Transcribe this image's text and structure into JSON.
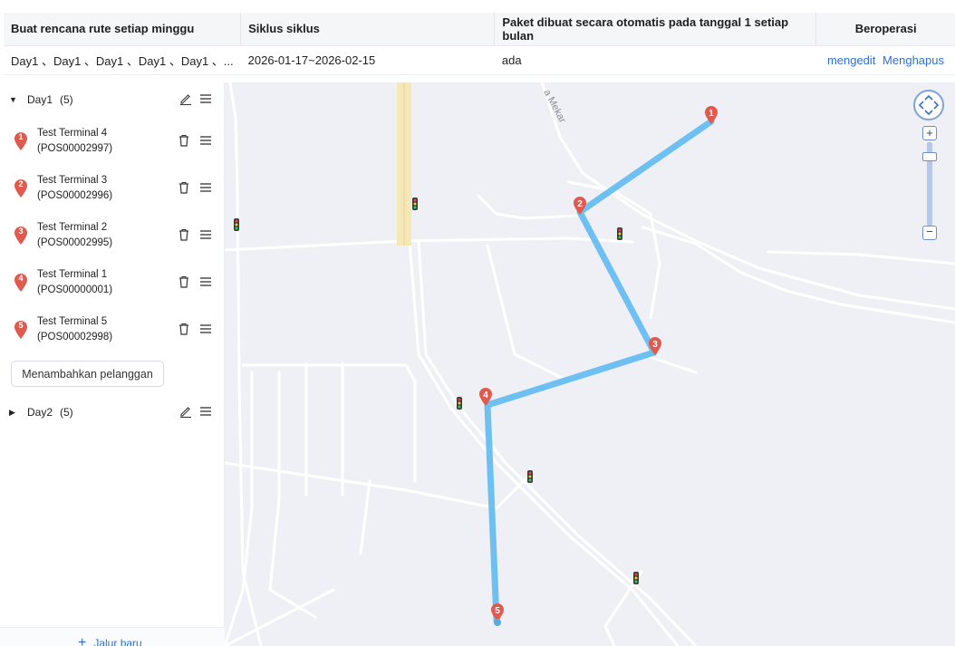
{
  "table": {
    "headers": [
      "Buat rencana rute setiap minggu",
      "Siklus siklus",
      "Paket dibuat secara otomatis pada tanggal 1 setiap bulan",
      "Beroperasi"
    ],
    "row": {
      "days": "Day1 、Day1 、Day1 、Day1 、Day1 、...",
      "cycle": "2026-01-17~2026-02-15",
      "auto_created": "ada",
      "edit_label": "mengedit",
      "delete_label": "Menghapus"
    }
  },
  "left_panel": {
    "day1": {
      "label": "Day1",
      "count": "(5)",
      "expanded": true
    },
    "stops": [
      {
        "number": "1",
        "name": "Test Terminal 4",
        "code": "(POS00002997)"
      },
      {
        "number": "2",
        "name": "Test Terminal 3",
        "code": "(POS00002996)"
      },
      {
        "number": "3",
        "name": "Test Terminal 2",
        "code": "(POS00002995)"
      },
      {
        "number": "4",
        "name": "Test Terminal 1",
        "code": "(POS00000001)"
      },
      {
        "number": "5",
        "name": "Test Terminal 5",
        "code": "(POS00002998)"
      }
    ],
    "add_customer_label": "Menambahkan pelanggan",
    "day2": {
      "label": "Day2",
      "count": "(5)",
      "expanded": false
    },
    "new_route_label": "Jalur baru"
  },
  "map": {
    "road_label": "a Mekar",
    "route_color": "#6ec0f2",
    "marker_color": "#e05a4f",
    "markers": [
      "1",
      "2",
      "3",
      "4",
      "5"
    ]
  },
  "colors": {
    "link": "#2f6fd6",
    "header_bg": "#f5f6f8",
    "map_bg": "#eef0f5"
  }
}
